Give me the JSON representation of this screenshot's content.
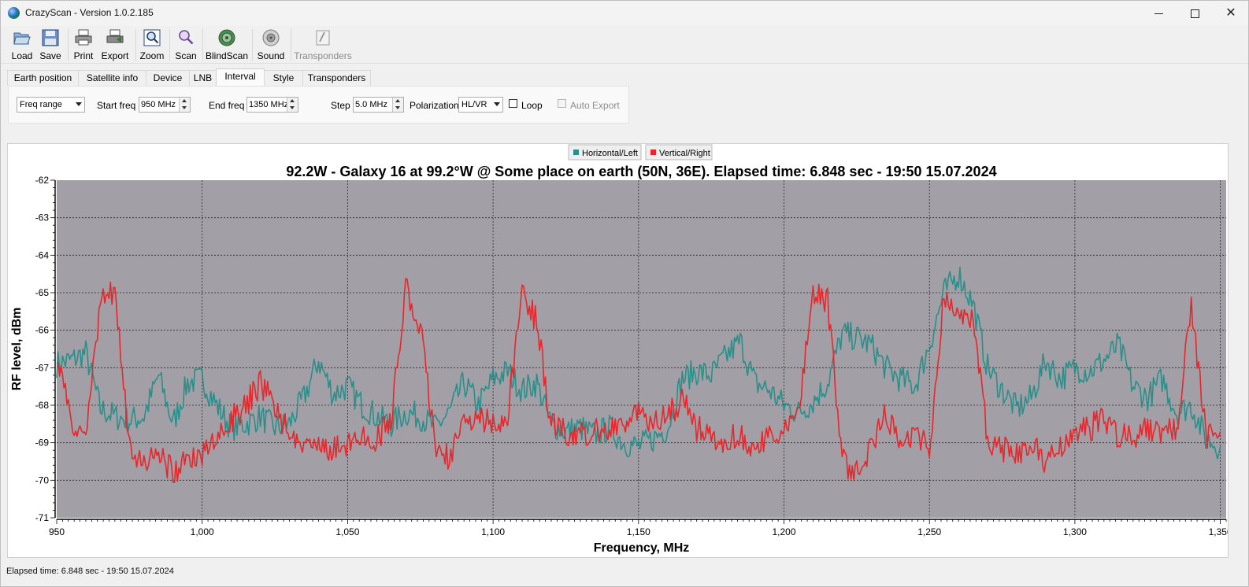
{
  "window": {
    "title": "CrazyScan - Version 1.0.2.185"
  },
  "toolbar": {
    "items": [
      {
        "label": "Load",
        "icon": "folder-open-icon"
      },
      {
        "label": "Save",
        "icon": "floppy-disk-icon"
      },
      {
        "label": "Print",
        "icon": "printer-icon"
      },
      {
        "label": "Export",
        "icon": "export-printer-icon"
      },
      {
        "label": "Zoom",
        "icon": "zoom-icon"
      },
      {
        "label": "Scan",
        "icon": "magnifier-icon"
      },
      {
        "label": "BlindScan",
        "icon": "satellite-dish-icon"
      },
      {
        "label": "Sound",
        "icon": "speaker-icon"
      },
      {
        "label": "Transponders",
        "icon": "transponders-icon",
        "disabled": true
      }
    ]
  },
  "tabs": [
    "Earth position",
    "Satellite info",
    "Device",
    "LNB",
    "Interval",
    "Style",
    "Transponders"
  ],
  "active_tab": "Interval",
  "interval": {
    "mode": "Freq range",
    "start_label": "Start freq",
    "start_value": "950 MHz",
    "end_label": "End freq",
    "end_value": "1350 MHz",
    "step_label": "Step",
    "step_value": "5.0 MHz",
    "pol_label": "Polarization",
    "pol_value": "HL/VR",
    "loop_label": "Loop",
    "loop_checked": false,
    "autoexport_label": "Auto Export",
    "autoexport_checked": false,
    "autoexport_disabled": true
  },
  "chart_data": {
    "type": "line",
    "title": "92.2W - Galaxy 16 at 99.2°W @ Some place on earth (50N, 36E). Elapsed time: 6.848 sec - 19:50 15.07.2024",
    "xlabel": "Frequency, MHz",
    "ylabel": "RF level, dBm",
    "xlim": [
      950,
      1352
    ],
    "ylim": [
      -71,
      -62
    ],
    "xticks": [
      950,
      1000,
      1050,
      1100,
      1150,
      1200,
      1250,
      1300,
      1350
    ],
    "xtick_labels": [
      "950",
      "1,000",
      "1,050",
      "1,100",
      "1,150",
      "1,200",
      "1,250",
      "1,300",
      "1,350"
    ],
    "yticks": [
      -62,
      -63,
      -64,
      -65,
      -66,
      -67,
      -68,
      -69,
      -70,
      -71
    ],
    "grid": true,
    "legend_position": "top-center",
    "series": [
      {
        "name": "Horizontal/Left",
        "color": "#2a8f8a",
        "x": [
          950,
          955,
          960,
          965,
          970,
          975,
          980,
          985,
          990,
          995,
          1000,
          1005,
          1010,
          1015,
          1020,
          1025,
          1030,
          1035,
          1040,
          1045,
          1050,
          1055,
          1060,
          1065,
          1070,
          1075,
          1080,
          1085,
          1090,
          1095,
          1100,
          1105,
          1110,
          1115,
          1120,
          1125,
          1130,
          1135,
          1140,
          1145,
          1150,
          1155,
          1160,
          1165,
          1170,
          1175,
          1180,
          1185,
          1190,
          1195,
          1200,
          1205,
          1210,
          1215,
          1220,
          1225,
          1230,
          1235,
          1240,
          1245,
          1250,
          1255,
          1260,
          1265,
          1270,
          1275,
          1280,
          1285,
          1290,
          1295,
          1300,
          1305,
          1310,
          1315,
          1320,
          1325,
          1330,
          1335,
          1340,
          1345,
          1350
        ],
        "values": [
          -66.9,
          -66.8,
          -66.6,
          -68.1,
          -68.3,
          -68.4,
          -68.3,
          -67.2,
          -68.5,
          -67.4,
          -67.3,
          -68.0,
          -68.6,
          -68.5,
          -68.3,
          -68.6,
          -68.5,
          -67.8,
          -66.8,
          -67.7,
          -67.5,
          -68.0,
          -68.3,
          -68.5,
          -68.2,
          -68.3,
          -68.6,
          -68.2,
          -67.4,
          -68.0,
          -67.3,
          -67.1,
          -67.6,
          -67.4,
          -68.5,
          -68.7,
          -68.6,
          -68.8,
          -68.6,
          -69.0,
          -69.1,
          -68.9,
          -68.6,
          -67.3,
          -67.1,
          -67.2,
          -66.7,
          -66.3,
          -67.4,
          -67.6,
          -68.0,
          -68.2,
          -67.9,
          -67.4,
          -66.1,
          -66.2,
          -66.4,
          -67.0,
          -67.3,
          -67.5,
          -66.4,
          -65.0,
          -64.5,
          -65.3,
          -67.0,
          -67.6,
          -68.1,
          -67.8,
          -66.8,
          -67.3,
          -67.0,
          -67.1,
          -66.8,
          -66.4,
          -67.5,
          -67.8,
          -67.3,
          -68.2,
          -68.0,
          -68.9,
          -69.1
        ]
      },
      {
        "name": "Vertical/Right",
        "color": "#e8262b",
        "x": [
          950,
          955,
          960,
          965,
          970,
          975,
          980,
          985,
          990,
          995,
          1000,
          1005,
          1010,
          1015,
          1020,
          1025,
          1030,
          1035,
          1040,
          1045,
          1050,
          1055,
          1060,
          1065,
          1070,
          1075,
          1080,
          1085,
          1090,
          1095,
          1100,
          1105,
          1110,
          1115,
          1120,
          1125,
          1130,
          1135,
          1140,
          1145,
          1150,
          1155,
          1160,
          1165,
          1170,
          1175,
          1180,
          1185,
          1190,
          1195,
          1200,
          1205,
          1210,
          1215,
          1220,
          1225,
          1230,
          1235,
          1240,
          1245,
          1250,
          1255,
          1260,
          1265,
          1270,
          1275,
          1280,
          1285,
          1290,
          1295,
          1300,
          1305,
          1310,
          1315,
          1320,
          1325,
          1330,
          1335,
          1340,
          1345,
          1350
        ],
        "values": [
          -66.5,
          -68.6,
          -68.9,
          -65.3,
          -64.9,
          -69.2,
          -69.6,
          -69.4,
          -69.8,
          -69.5,
          -69.4,
          -69.0,
          -68.4,
          -68.0,
          -67.4,
          -68.0,
          -68.8,
          -69.3,
          -69.1,
          -69.2,
          -69.0,
          -68.8,
          -68.9,
          -68.4,
          -64.8,
          -65.9,
          -69.0,
          -69.4,
          -68.3,
          -68.4,
          -68.5,
          -68.2,
          -64.9,
          -65.8,
          -68.5,
          -68.7,
          -68.8,
          -68.6,
          -68.7,
          -68.5,
          -68.3,
          -68.5,
          -68.3,
          -67.8,
          -68.6,
          -68.9,
          -68.9,
          -68.8,
          -69.1,
          -68.9,
          -68.6,
          -68.2,
          -65.0,
          -65.2,
          -69.5,
          -69.8,
          -69.2,
          -68.2,
          -69.0,
          -68.8,
          -69.2,
          -65.0,
          -65.5,
          -65.8,
          -68.9,
          -69.2,
          -69.3,
          -69.0,
          -69.6,
          -69.1,
          -68.7,
          -68.6,
          -68.4,
          -68.8,
          -68.9,
          -68.6,
          -68.7,
          -68.6,
          -65.4,
          -68.8,
          -68.7
        ]
      }
    ]
  },
  "status": {
    "text": "Elapsed time: 6.848 sec - 19:50 15.07.2024"
  }
}
